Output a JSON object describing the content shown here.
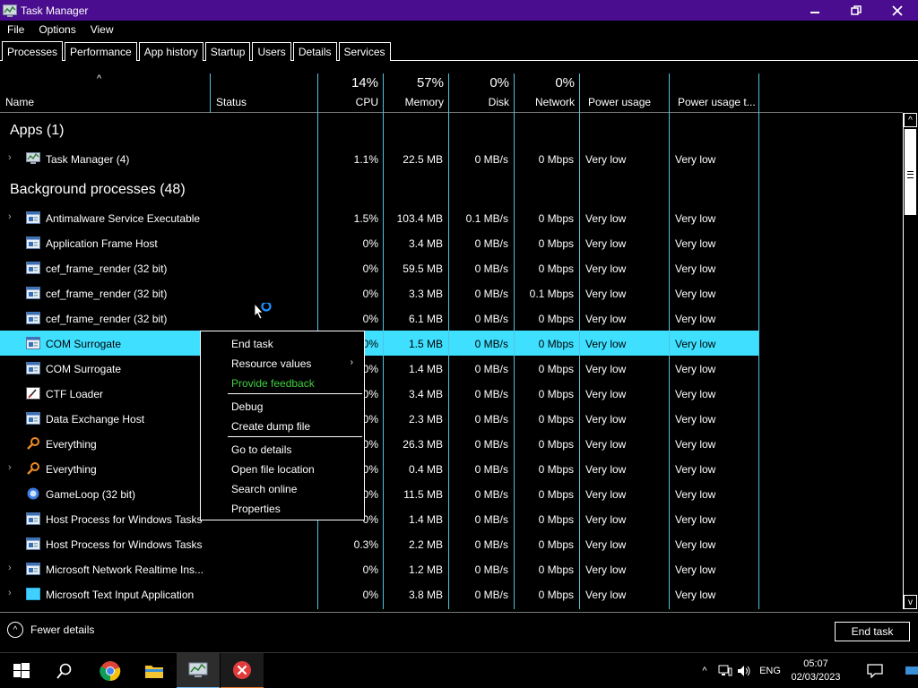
{
  "window": {
    "title": "Task Manager",
    "buttons": [
      "minimize",
      "restore",
      "close"
    ]
  },
  "menu": [
    "File",
    "Options",
    "View"
  ],
  "tabs": [
    "Processes",
    "Performance",
    "App history",
    "Startup",
    "Users",
    "Details",
    "Services"
  ],
  "active_tab": "Processes",
  "columns": {
    "name": "Name",
    "status": "Status",
    "cpu": {
      "pct": "14%",
      "label": "CPU"
    },
    "memory": {
      "pct": "57%",
      "label": "Memory"
    },
    "disk": {
      "pct": "0%",
      "label": "Disk"
    },
    "network": {
      "pct": "0%",
      "label": "Network"
    },
    "power": "Power usage",
    "power_trend": "Power usage t..."
  },
  "groups": {
    "apps": "Apps (1)",
    "background": "Background processes (48)"
  },
  "rows": [
    {
      "name": "Task Manager (4)",
      "cpu": "1.1%",
      "mem": "22.5 MB",
      "disk": "0 MB/s",
      "net": "0 Mbps",
      "pow": "Very low",
      "powt": "Very low",
      "expand": true,
      "icon": "taskmgr-icon"
    },
    {
      "name": "Antimalware Service Executable",
      "cpu": "1.5%",
      "mem": "103.4 MB",
      "disk": "0.1 MB/s",
      "net": "0 Mbps",
      "pow": "Very low",
      "powt": "Very low",
      "expand": true,
      "icon": "service-icon"
    },
    {
      "name": "Application Frame Host",
      "cpu": "0%",
      "mem": "3.4 MB",
      "disk": "0 MB/s",
      "net": "0 Mbps",
      "pow": "Very low",
      "powt": "Very low",
      "expand": false,
      "icon": "service-icon"
    },
    {
      "name": "cef_frame_render (32 bit)",
      "cpu": "0%",
      "mem": "59.5 MB",
      "disk": "0 MB/s",
      "net": "0 Mbps",
      "pow": "Very low",
      "powt": "Very low",
      "expand": false,
      "icon": "service-icon"
    },
    {
      "name": "cef_frame_render (32 bit)",
      "cpu": "0%",
      "mem": "3.3 MB",
      "disk": "0 MB/s",
      "net": "0.1 Mbps",
      "pow": "Very low",
      "powt": "Very low",
      "expand": false,
      "icon": "service-icon"
    },
    {
      "name": "cef_frame_render (32 bit)",
      "cpu": "0%",
      "mem": "6.1 MB",
      "disk": "0 MB/s",
      "net": "0 Mbps",
      "pow": "Very low",
      "powt": "Very low",
      "expand": false,
      "icon": "service-icon"
    },
    {
      "name": "COM Surrogate",
      "cpu": "0%",
      "mem": "1.5 MB",
      "disk": "0 MB/s",
      "net": "0 Mbps",
      "pow": "Very low",
      "powt": "Very low",
      "expand": false,
      "icon": "service-icon",
      "selected": true
    },
    {
      "name": "COM Surrogate",
      "cpu": "0%",
      "mem": "1.4 MB",
      "disk": "0 MB/s",
      "net": "0 Mbps",
      "pow": "Very low",
      "powt": "Very low",
      "expand": false,
      "icon": "service-icon"
    },
    {
      "name": "CTF Loader",
      "cpu": "0%",
      "mem": "3.4 MB",
      "disk": "0 MB/s",
      "net": "0 Mbps",
      "pow": "Very low",
      "powt": "Very low",
      "expand": false,
      "icon": "ctf-icon"
    },
    {
      "name": "Data Exchange Host",
      "cpu": "0%",
      "mem": "2.3 MB",
      "disk": "0 MB/s",
      "net": "0 Mbps",
      "pow": "Very low",
      "powt": "Very low",
      "expand": false,
      "icon": "service-icon"
    },
    {
      "name": "Everything",
      "cpu": "0%",
      "mem": "26.3 MB",
      "disk": "0 MB/s",
      "net": "0 Mbps",
      "pow": "Very low",
      "powt": "Very low",
      "expand": false,
      "icon": "magnifier-icon"
    },
    {
      "name": "Everything",
      "cpu": "0%",
      "mem": "0.4 MB",
      "disk": "0 MB/s",
      "net": "0 Mbps",
      "pow": "Very low",
      "powt": "Very low",
      "expand": true,
      "icon": "magnifier-icon"
    },
    {
      "name": "GameLoop (32 bit)",
      "cpu": "0%",
      "mem": "11.5 MB",
      "disk": "0 MB/s",
      "net": "0 Mbps",
      "pow": "Very low",
      "powt": "Very low",
      "expand": false,
      "icon": "gameloop-icon"
    },
    {
      "name": "Host Process for Windows Tasks",
      "cpu": "0%",
      "mem": "1.4 MB",
      "disk": "0 MB/s",
      "net": "0 Mbps",
      "pow": "Very low",
      "powt": "Very low",
      "expand": false,
      "icon": "service-icon"
    },
    {
      "name": "Host Process for Windows Tasks",
      "cpu": "0.3%",
      "mem": "2.2 MB",
      "disk": "0 MB/s",
      "net": "0 Mbps",
      "pow": "Very low",
      "powt": "Very low",
      "expand": false,
      "icon": "service-icon"
    },
    {
      "name": "Microsoft Network Realtime Ins...",
      "cpu": "0%",
      "mem": "1.2 MB",
      "disk": "0 MB/s",
      "net": "0 Mbps",
      "pow": "Very low",
      "powt": "Very low",
      "expand": true,
      "icon": "service-icon"
    },
    {
      "name": "Microsoft Text Input Application",
      "cpu": "0%",
      "mem": "3.8 MB",
      "disk": "0 MB/s",
      "net": "0 Mbps",
      "pow": "Very low",
      "powt": "Very low",
      "expand": true,
      "icon": "textinput-icon"
    }
  ],
  "context_menu": {
    "items": [
      "End task",
      "Resource values",
      "Provide feedback",
      "Debug",
      "Create dump file",
      "Go to details",
      "Open file location",
      "Search online",
      "Properties"
    ],
    "highlight_color": "#3fd13f"
  },
  "footer": {
    "fewer_details": "Fewer details",
    "end_task": "End task"
  },
  "taskbar": {
    "apps": [
      "start-icon",
      "search-icon",
      "chrome-icon",
      "file-explorer-icon",
      "task-manager-icon",
      "close-app-icon"
    ],
    "language": "ENG",
    "time": "05:07",
    "date": "02/03/2023"
  },
  "colors": {
    "titlebar": "#4a0d8f",
    "selection": "#3fe0ff",
    "divider": "#4fc3dd",
    "accent": "#76b9ed"
  }
}
